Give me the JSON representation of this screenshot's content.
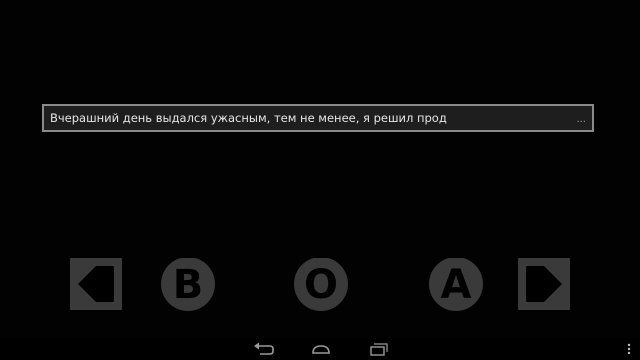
{
  "dialog": {
    "text": "Вчерашний день выдался ужасным, тем не менее, я решил прод",
    "more_indicator": "..."
  },
  "controls": {
    "left_icon": "left-arrow-icon",
    "b_label": "B",
    "o_label": "O",
    "a_label": "A",
    "right_icon": "right-arrow-icon"
  },
  "navbar": {
    "back_icon": "back-icon",
    "home_icon": "home-icon",
    "recents_icon": "recent-apps-icon",
    "menu_icon": "overflow-menu-icon"
  },
  "colors": {
    "background": "#020202",
    "control_fill": "#3a3a3a",
    "control_glyph": "#000000",
    "dialog_border": "#8a8a8a",
    "dialog_bg": "#1e1e1e",
    "text": "#e6e6e6"
  }
}
